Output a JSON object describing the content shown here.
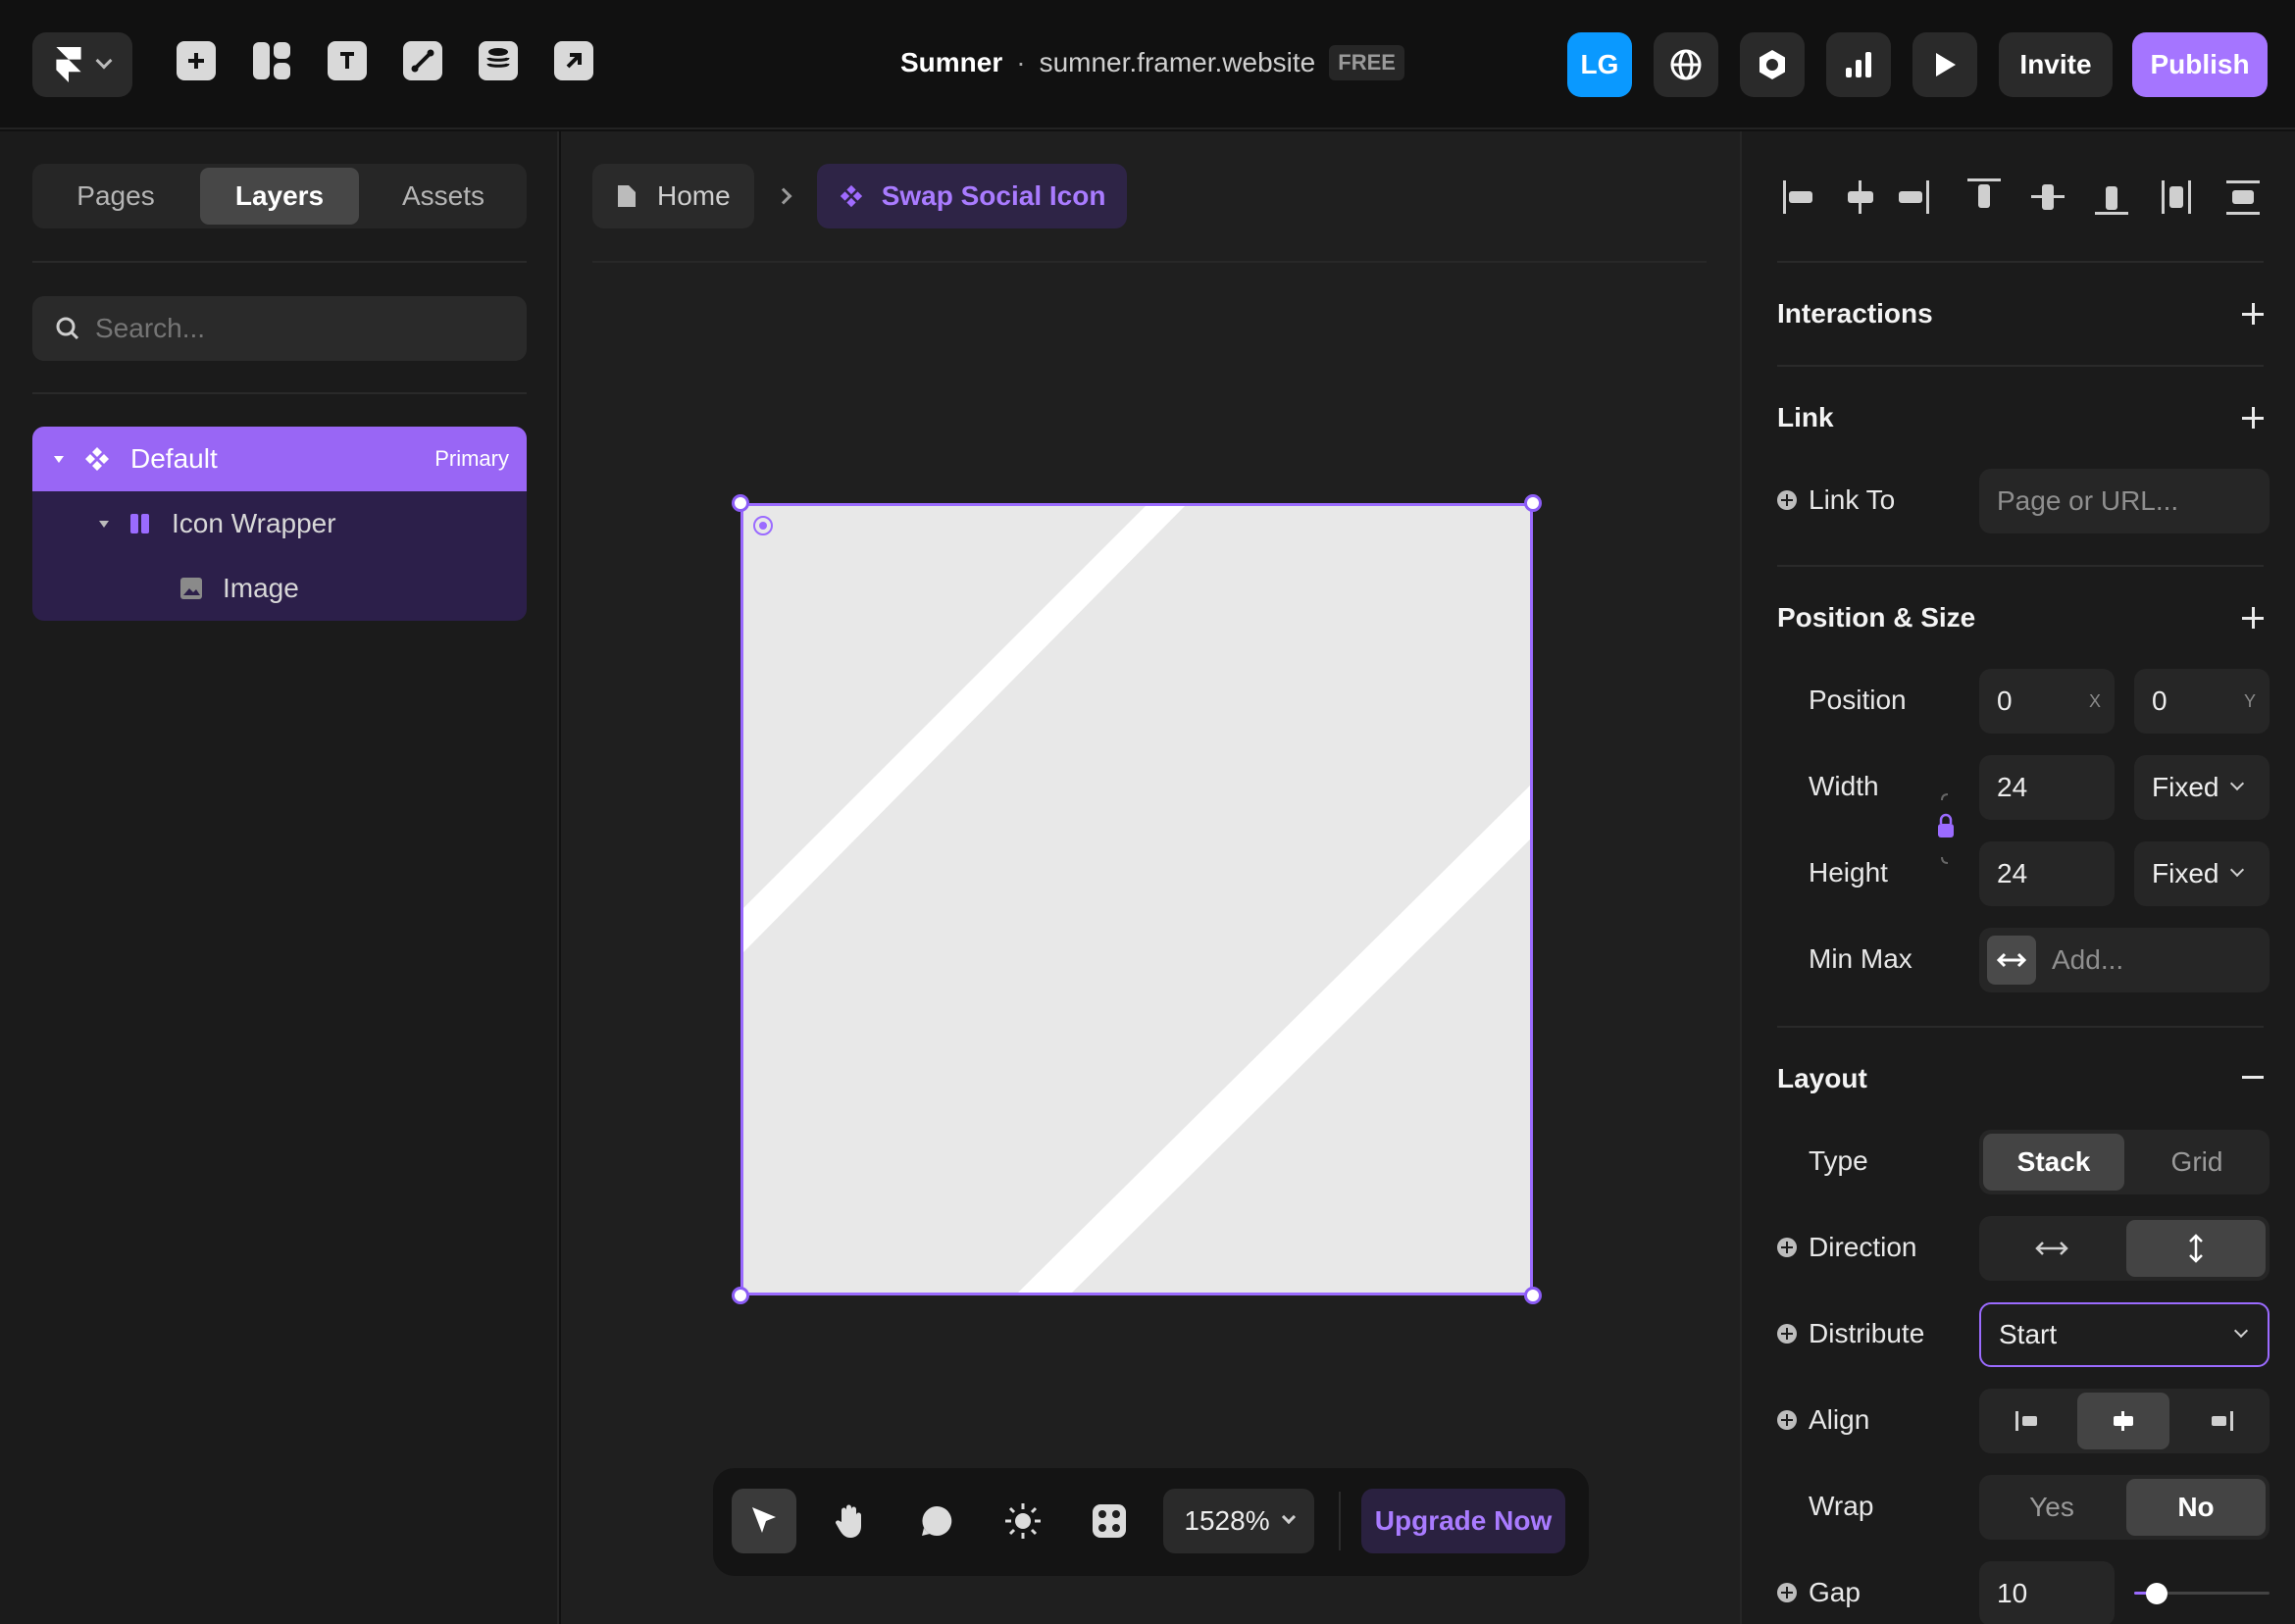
{
  "topbar": {
    "project_name": "Sumner",
    "separator": "·",
    "site_url": "sumner.framer.website",
    "plan_badge": "FREE",
    "avatar_initials": "LG",
    "invite_label": "Invite",
    "publish_label": "Publish"
  },
  "left_panel": {
    "tabs": [
      "Pages",
      "Layers",
      "Assets"
    ],
    "active_tab": "Layers",
    "search_placeholder": "Search...",
    "layers": [
      {
        "name": "Default",
        "tag": "Primary",
        "icon": "component-icon",
        "selected": true
      },
      {
        "name": "Icon Wrapper",
        "icon": "stack-icon"
      },
      {
        "name": "Image",
        "icon": "image-icon"
      }
    ]
  },
  "canvas": {
    "breadcrumb": [
      {
        "label": "Home",
        "icon": "page-icon"
      },
      {
        "label": "Swap Social Icon",
        "icon": "component-icon"
      }
    ],
    "zoom": "1528%",
    "upgrade_label": "Upgrade Now"
  },
  "right_panel": {
    "interactions": {
      "title": "Interactions"
    },
    "link": {
      "title": "Link",
      "link_to_label": "Link To",
      "link_to_placeholder": "Page or URL..."
    },
    "position_size": {
      "title": "Position & Size",
      "position_label": "Position",
      "pos_x": "0",
      "pos_x_unit": "X",
      "pos_y": "0",
      "pos_y_unit": "Y",
      "width_label": "Width",
      "width": "24",
      "width_mode": "Fixed",
      "height_label": "Height",
      "height": "24",
      "height_mode": "Fixed",
      "minmax_label": "Min Max",
      "minmax_placeholder": "Add..."
    },
    "layout": {
      "title": "Layout",
      "type_label": "Type",
      "type_options": [
        "Stack",
        "Grid"
      ],
      "type_selected": "Stack",
      "direction_label": "Direction",
      "direction_selected": "vertical",
      "distribute_label": "Distribute",
      "distribute_value": "Start",
      "align_label": "Align",
      "align_selected": "center",
      "wrap_label": "Wrap",
      "wrap_options": [
        "Yes",
        "No"
      ],
      "wrap_selected": "No",
      "gap_label": "Gap",
      "gap_value": "10"
    }
  },
  "colors": {
    "accent": "#8b5cf6",
    "blue": "#0a99ff",
    "bg": "#111111",
    "panel": "#1b1b1b"
  }
}
